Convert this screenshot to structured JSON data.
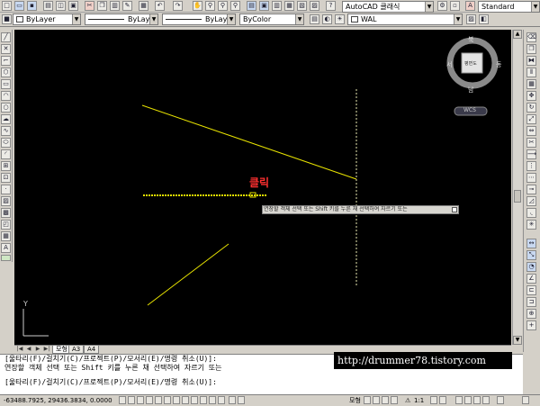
{
  "toolbar": {
    "workspace": "AutoCAD 클래식",
    "style": "Standard",
    "layer": "ByLayer",
    "linetype": "ByLayer",
    "lineweight": "ByLayer",
    "color": "ByColor",
    "layer_state": "WAL"
  },
  "viewcube": {
    "north": "북",
    "south": "남",
    "east": "동",
    "west": "서",
    "face": "평면도",
    "wcs": "WCS"
  },
  "canvas": {
    "annotation": "클릭",
    "tooltip": "연장할 객체 선택 또는 Shift 키를 누른 채 선택하여 자르기 또는",
    "ucs_y": "Y"
  },
  "tabs": [
    "모형",
    "A3",
    "A4"
  ],
  "command": {
    "line1": "[울타리(F)/걸치기(C)/프로젝트(P)/모서리(E)/명령 취소(U)]:",
    "line2": "연장할 객체 선택 또는 Shift 키를 누른 채 선택하여 자르기 또는",
    "line3": "[울타리(F)/걸치기(C)/프로젝트(P)/모서리(E)/명령 취소(U)]:"
  },
  "watermark": "http://drummer78.tistory.com",
  "status": {
    "coords": "-63488.7925, 29436.3834, 0.0000",
    "model": "모형",
    "scale": "1:1"
  },
  "colors": {
    "canvas_bg": "#000000",
    "line": "#e8e300",
    "annotation": "#ff3030"
  }
}
